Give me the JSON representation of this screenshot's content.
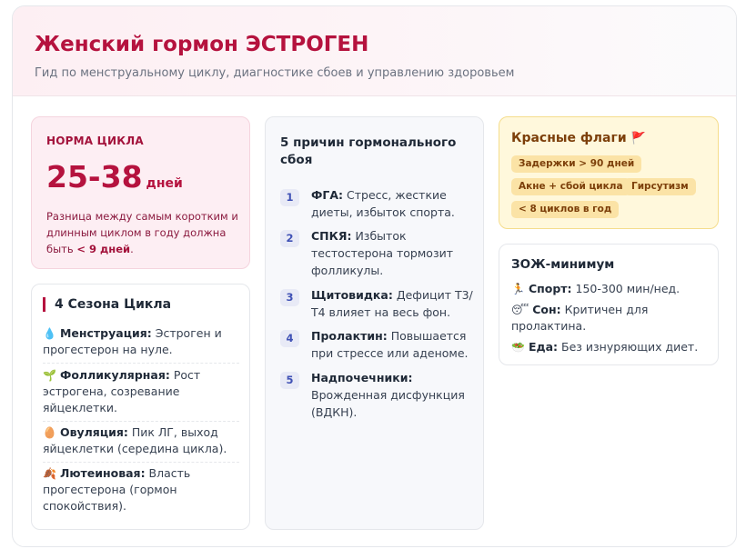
{
  "header": {
    "title": "Женский гормон ЭСТРОГЕН",
    "subtitle": "Гид по менструальному циклу, диагностике сбоев и управлению здоровьем"
  },
  "norm": {
    "label": "Норма цикла",
    "value": "25-38",
    "unit": "дней",
    "text_prefix": "Разница между самым коротким и длинным циклом в году должна быть ",
    "text_bold": "< 9 дней",
    "text_suffix": "."
  },
  "seasons": {
    "title": "4 Сезона Цикла",
    "items": [
      {
        "icon": "blood-drop-icon",
        "glyph": "💧",
        "name": "Менструация:",
        "text": " Эстроген и прогестерон на нуле."
      },
      {
        "icon": "sprout-icon",
        "glyph": "🌱",
        "name": "Фолликулярная:",
        "text": " Рост эстрогена, созревание яйцеклетки."
      },
      {
        "icon": "egg-icon",
        "glyph": "🥚",
        "name": "Овуляция:",
        "text": " Пик ЛГ, выход яйцеклетки (середина цикла)."
      },
      {
        "icon": "autumn-leaf-icon",
        "glyph": "🍂",
        "name": "Лютеиновая:",
        "text": " Власть прогестерона (гормон спокойствия)."
      }
    ]
  },
  "reasons": {
    "title": "5 причин гормонального сбоя",
    "items": [
      {
        "num": "1",
        "name": "ФГА:",
        "text": " Стресс, жесткие диеты, избыток спорта."
      },
      {
        "num": "2",
        "name": "СПКЯ:",
        "text": " Избыток тестостерона тормозит фолликулы."
      },
      {
        "num": "3",
        "name": "Щитовидка:",
        "text": " Дефицит Т3/Т4 влияет на весь фон."
      },
      {
        "num": "4",
        "name": "Пролактин:",
        "text": " Повышается при стрессе или аденоме."
      },
      {
        "num": "5",
        "name": "Надпочечники:",
        "text": " Врожденная дисфункция (ВДКН)."
      }
    ]
  },
  "flags": {
    "title": "Красные флаги",
    "icon": "red-flag-icon",
    "chips": [
      "Задержки > 90 дней",
      "Акне + сбой цикла",
      "Гирсутизм",
      "< 8 циклов в год"
    ]
  },
  "health": {
    "title": "ЗОЖ-минимум",
    "items": [
      {
        "icon": "running-icon",
        "glyph": "🏃",
        "name": "Спорт:",
        "text": " 150-300 мин/нед."
      },
      {
        "icon": "sleep-icon",
        "glyph": "😴",
        "name": "Сон:",
        "text": " Критичен для пролактина."
      },
      {
        "icon": "salad-icon",
        "glyph": "🥗",
        "name": "Еда:",
        "text": " Без изнуряющих диет."
      }
    ]
  },
  "colors": {
    "accent": "#b5123e",
    "norm_bg": "#fdeef3",
    "flags_bg": "#fff8dc",
    "reason_num": "#3f51b5"
  }
}
